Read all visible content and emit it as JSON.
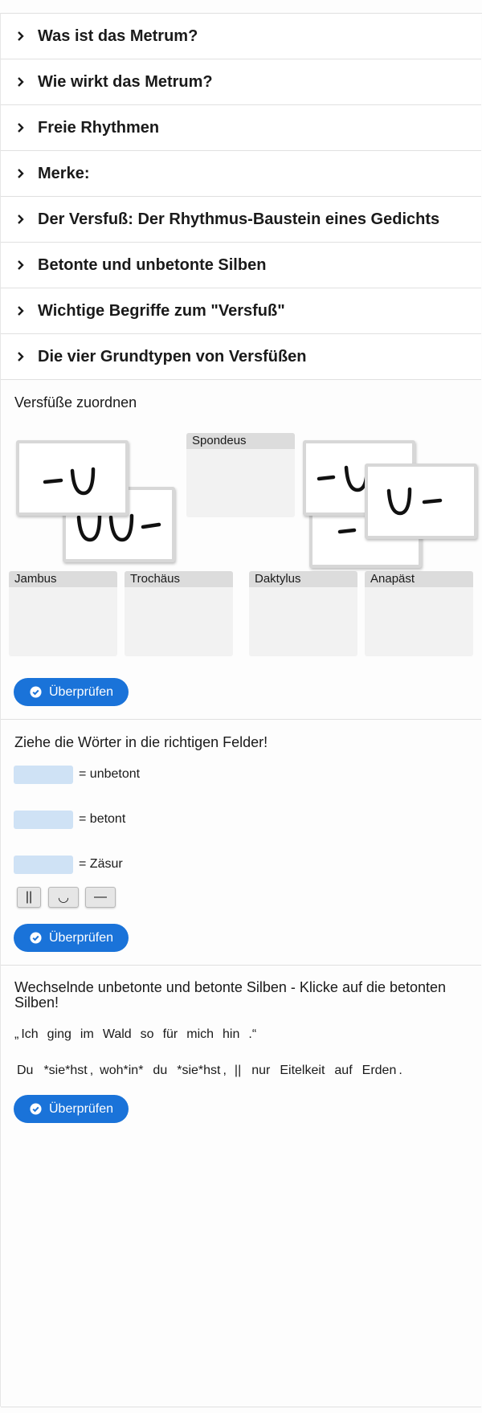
{
  "accordion": [
    {
      "label": "Was ist das Metrum?"
    },
    {
      "label": "Wie wirkt das Metrum?"
    },
    {
      "label": "Freie Rhythmen"
    },
    {
      "label": "Merke:"
    },
    {
      "label": "Der Versfuß: Der Rhythmus-Baustein eines Gedichts"
    },
    {
      "label": "Betonte und unbetonte Silben"
    },
    {
      "label": "Wichtige Begriffe zum \"Versfuß\""
    },
    {
      "label": "Die vier Grundtypen von Versfüßen"
    }
  ],
  "drag": {
    "title": "Versfüße zuordnen",
    "zones": {
      "spondeus": "Spondeus",
      "jambus": "Jambus",
      "trochaeus": "Trochäus",
      "daktylus": "Daktylus",
      "anapaest": "Anapäst"
    },
    "cards": [
      "—◡",
      "◡◡—",
      "—◡",
      "—",
      "◡—"
    ],
    "check_label": "Überprüfen"
  },
  "fill": {
    "title": "Ziehe die Wörter in die richtigen Felder!",
    "rows": [
      "= unbetont",
      "= betont",
      "= Zäsur"
    ],
    "tokens": [
      "||",
      "◡",
      "—"
    ],
    "check_label": "Überprüfen"
  },
  "mark": {
    "title": "Wechselnde unbetonte und betonte Silben - Klicke auf die betonten Silben!",
    "line1": [
      "„",
      "Ich",
      "ging",
      "im",
      "Wald",
      "so",
      "für",
      "mich",
      "hin",
      ".“"
    ],
    "line2": [
      "Du",
      "*sie*hst",
      ",",
      "woh*in*",
      "du",
      "*sie*hst",
      ",",
      "||",
      "nur",
      "Eitelkeit",
      "auf",
      "Erden",
      "."
    ],
    "check_label": "Überprüfen"
  },
  "colors": {
    "accent": "#1a73d9",
    "slot": "#cfe2f5",
    "zone": "#f2f2f2",
    "zone_label": "#dcdcdc"
  },
  "icons": {
    "accordion": "chevron-right-icon",
    "check": "check-circle-icon"
  }
}
